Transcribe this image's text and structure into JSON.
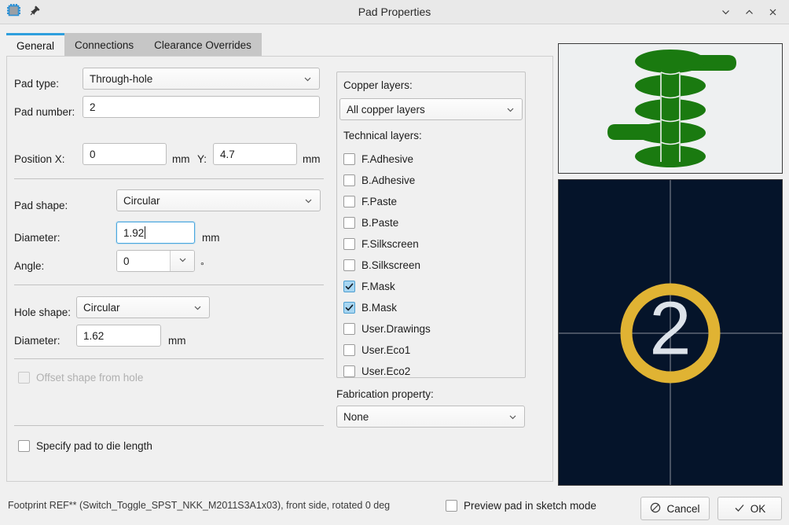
{
  "window": {
    "title": "Pad Properties",
    "app_icon": "kicad-pcb-icon",
    "pin_icon": "pin-icon",
    "controls": [
      {
        "name": "minimize-button",
        "icon": "chevron-down-icon"
      },
      {
        "name": "maximize-button",
        "icon": "chevron-up-icon"
      },
      {
        "name": "close-button",
        "icon": "close-icon"
      }
    ]
  },
  "tabs": [
    {
      "label": "General",
      "active": true
    },
    {
      "label": "Connections",
      "active": false
    },
    {
      "label": "Clearance Overrides",
      "active": false
    }
  ],
  "general": {
    "pad_type_label": "Pad type:",
    "pad_type_value": "Through-hole",
    "pad_number_label": "Pad number:",
    "pad_number_value": "2",
    "position_x_label": "Position X:",
    "position_x_value": "0",
    "position_x_unit": "mm",
    "position_y_label": "Y:",
    "position_y_value": "4.7",
    "position_y_unit": "mm",
    "pad_shape_label": "Pad shape:",
    "pad_shape_value": "Circular",
    "pad_diameter_label": "Diameter:",
    "pad_diameter_value": "1.92",
    "pad_diameter_unit": "mm",
    "angle_label": "Angle:",
    "angle_value": "0",
    "angle_unit": "°",
    "hole_shape_label": "Hole shape:",
    "hole_shape_value": "Circular",
    "hole_diameter_label": "Diameter:",
    "hole_diameter_value": "1.62",
    "hole_diameter_unit": "mm",
    "offset_shape_label": "Offset shape from hole",
    "offset_shape_checked": false,
    "offset_shape_disabled": true,
    "die_length_label": "Specify pad to die length",
    "die_length_checked": false
  },
  "layers": {
    "copper_layers_label": "Copper layers:",
    "copper_layers_value": "All copper layers",
    "technical_layers_label": "Technical layers:",
    "technical_layers": [
      {
        "label": "F.Adhesive",
        "checked": false
      },
      {
        "label": "B.Adhesive",
        "checked": false
      },
      {
        "label": "F.Paste",
        "checked": false
      },
      {
        "label": "B.Paste",
        "checked": false
      },
      {
        "label": "F.Silkscreen",
        "checked": false
      },
      {
        "label": "B.Silkscreen",
        "checked": false
      },
      {
        "label": "F.Mask",
        "checked": true
      },
      {
        "label": "B.Mask",
        "checked": true
      },
      {
        "label": "User.Drawings",
        "checked": false
      },
      {
        "label": "User.Eco1",
        "checked": false
      },
      {
        "label": "User.Eco2",
        "checked": false
      }
    ],
    "fabrication_property_label": "Fabrication property:",
    "fabrication_property_value": "None"
  },
  "preview": {
    "stackup_alt": "through-hole pad layer stackup side view",
    "stackup_color": "#1a7a10",
    "canvas_background": "#05142a",
    "pad_ring_color": "#e0b333",
    "pad_label": "2",
    "pad_label_color": "#dde3ea",
    "crosshair_color": "#8b8f99"
  },
  "footer": {
    "status": "Footprint REF** (Switch_Toggle_SPST_NKK_M2011S3A1x03), front side, rotated 0 deg",
    "sketch_mode_label": "Preview pad in sketch mode",
    "sketch_mode_checked": false,
    "cancel_label": "Cancel",
    "cancel_icon": "cancel-icon",
    "ok_label": "OK",
    "ok_icon": "check-icon"
  }
}
